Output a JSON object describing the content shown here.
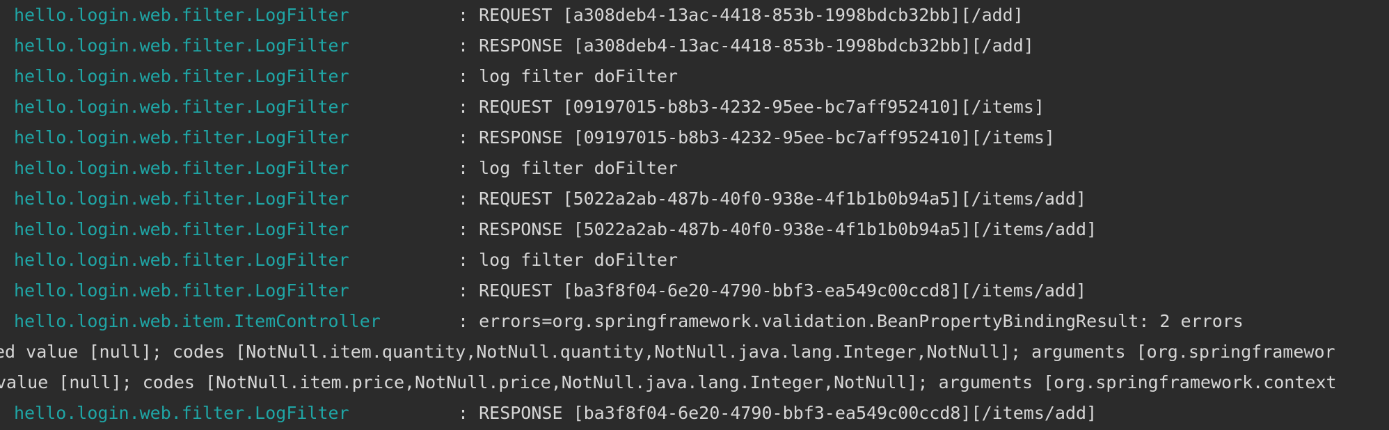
{
  "console": {
    "lines": [
      {
        "logger": "hello.login.web.filter.LogFilter",
        "message": ": REQUEST [a308deb4-13ac-4418-853b-1998bdcb32bb][/add]"
      },
      {
        "logger": "hello.login.web.filter.LogFilter",
        "message": ": RESPONSE [a308deb4-13ac-4418-853b-1998bdcb32bb][/add]"
      },
      {
        "logger": "hello.login.web.filter.LogFilter",
        "message": ": log filter doFilter"
      },
      {
        "logger": "hello.login.web.filter.LogFilter",
        "message": ": REQUEST [09197015-b8b3-4232-95ee-bc7aff952410][/items]"
      },
      {
        "logger": "hello.login.web.filter.LogFilter",
        "message": ": RESPONSE [09197015-b8b3-4232-95ee-bc7aff952410][/items]"
      },
      {
        "logger": "hello.login.web.filter.LogFilter",
        "message": ": log filter doFilter"
      },
      {
        "logger": "hello.login.web.filter.LogFilter",
        "message": ": REQUEST [5022a2ab-487b-40f0-938e-4f1b1b0b94a5][/items/add]"
      },
      {
        "logger": "hello.login.web.filter.LogFilter",
        "message": ": RESPONSE [5022a2ab-487b-40f0-938e-4f1b1b0b94a5][/items/add]"
      },
      {
        "logger": "hello.login.web.filter.LogFilter",
        "message": ": log filter doFilter"
      },
      {
        "logger": "hello.login.web.filter.LogFilter",
        "message": ": REQUEST [ba3f8f04-6e20-4790-bbf3-ea549c00ccd8][/items/add]"
      },
      {
        "logger": "hello.login.web.item.ItemController",
        "message": ": errors=org.springframework.validation.BeanPropertyBindingResult: 2 errors"
      },
      {
        "continuation": "ed value [null]; codes [NotNull.item.quantity,NotNull.quantity,NotNull.java.lang.Integer,NotNull]; arguments [org.springframewor"
      },
      {
        "continuation": "value [null]; codes [NotNull.item.price,NotNull.price,NotNull.java.lang.Integer,NotNull]; arguments [org.springframework.context"
      },
      {
        "logger": "hello.login.web.filter.LogFilter",
        "message": ": RESPONSE [ba3f8f04-6e20-4790-bbf3-ea549c00ccd8][/items/add]"
      }
    ]
  },
  "colors": {
    "background": "#2b2b2b",
    "logger": "#1fa6a6",
    "message": "#d6d6d6"
  }
}
